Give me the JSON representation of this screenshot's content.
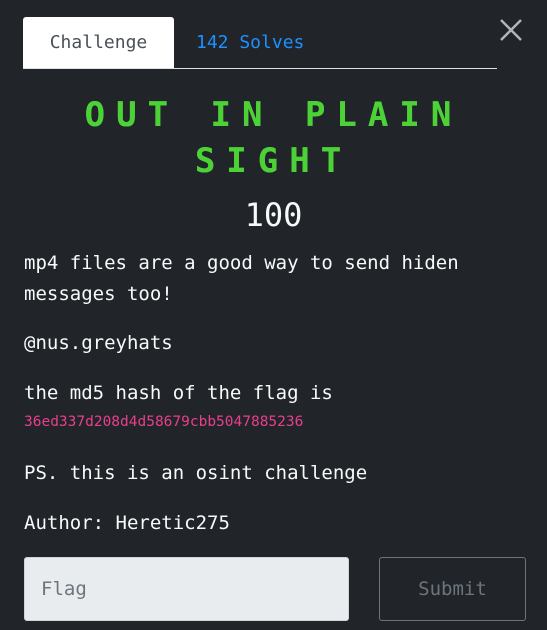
{
  "tabs": [
    {
      "label": "Challenge"
    },
    {
      "label": "142 Solves"
    }
  ],
  "challenge": {
    "title_line1": "OUT IN PLAIN",
    "title_line2": "SIGHT",
    "points": "100",
    "description": {
      "line1": "mp4 files are a good way to send hiden messages too!",
      "line2": "@nus.greyhats",
      "line3": "the md5 hash of the flag is",
      "hash": "36ed337d208d4d58679cbb5047885236",
      "line4": "PS. this is an osint challenge",
      "line5": "Author: Heretic275"
    }
  },
  "form": {
    "flag_placeholder": "Flag",
    "submit_label": "Submit"
  },
  "colors": {
    "background": "#212529",
    "title": "#4cd137",
    "tab_link": "#1e90ff",
    "hash": "#e83e8c"
  },
  "icons": {
    "close": "close-icon"
  }
}
